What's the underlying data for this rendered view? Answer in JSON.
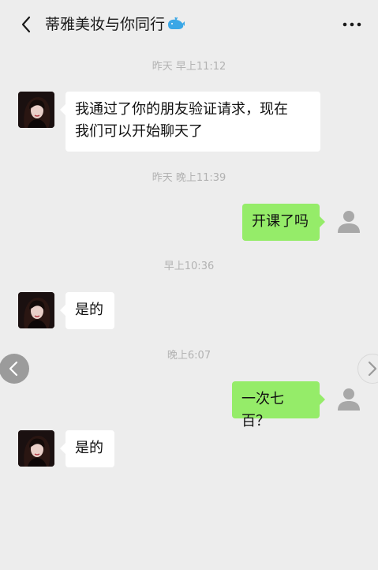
{
  "header": {
    "title": "蒂雅美妆与你同行",
    "back_icon": "chevron-left-icon",
    "more_icon": "more-dots-icon",
    "title_emoji": "whale-icon"
  },
  "messages": [
    {
      "type": "time",
      "text": "昨天 早上11:12"
    },
    {
      "type": "received",
      "text_line1": "我通过了你的朋友验证请求，现在",
      "text_line2": "我们可以开始聊天了"
    },
    {
      "type": "time",
      "text": "昨天 晚上11:39"
    },
    {
      "type": "sent",
      "text": "开课了吗"
    },
    {
      "type": "time",
      "text": "早上10:36"
    },
    {
      "type": "received",
      "text": "是的"
    },
    {
      "type": "time",
      "text": "晚上6:07"
    },
    {
      "type": "sent",
      "text": "一次七百？"
    },
    {
      "type": "received",
      "text": "是的"
    }
  ],
  "colors": {
    "background": "#ededed",
    "sent_bubble": "#95ec69",
    "received_bubble": "#ffffff",
    "timestamp": "#b2b2b2"
  }
}
